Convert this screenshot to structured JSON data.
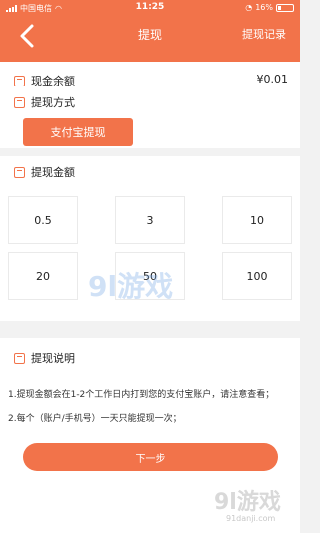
{
  "status": {
    "carrier": "中国电信",
    "time": "11:25",
    "battery": "16%"
  },
  "nav": {
    "title": "提现",
    "record": "提现记录"
  },
  "balance": {
    "label": "现金余额",
    "value": "¥0.01"
  },
  "method": {
    "label": "提现方式",
    "alipay": "支付宝提现"
  },
  "amount": {
    "label": "提现金额",
    "options": [
      "0.5",
      "3",
      "10",
      "20",
      "50",
      "100"
    ]
  },
  "notes": {
    "label": "提现说明",
    "lines": [
      "1.提现金额会在1-2个工作日内打到您的支付宝账户，请注意查看；",
      "2.每个（账户/手机号）一天只能提现一次；"
    ]
  },
  "next": "下一步",
  "watermark": {
    "logo": "9l游戏",
    "site": "91danji.com"
  },
  "colors": {
    "accent": "#f2734a"
  }
}
